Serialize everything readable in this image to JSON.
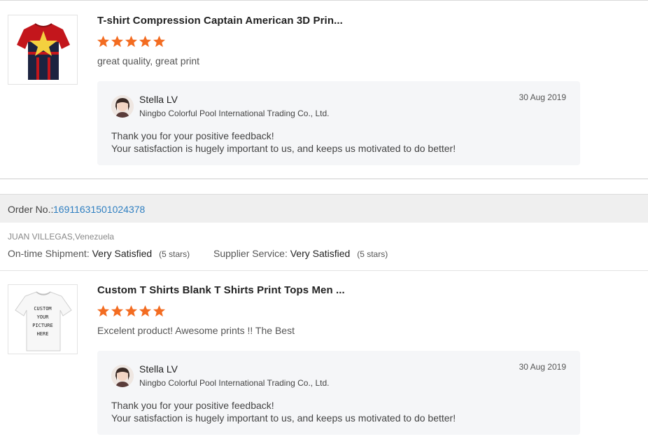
{
  "reviews": [
    {
      "title": "T-shirt Compression Captain American 3D Prin...",
      "rating": 5,
      "comment": "great quality, great print",
      "reply": {
        "name": "Stella LV",
        "company": "Ningbo Colorful Pool International Trading Co., Ltd.",
        "date": "30 Aug 2019",
        "line1": "Thank you for your positive feedback!",
        "line2": "Your satisfaction is hugely important to us, and keeps us motivated to do better!"
      }
    },
    {
      "title": "Custom T Shirts Blank T Shirts Print Tops Men ...",
      "rating": 5,
      "comment": "Excelent product! Awesome prints !! The Best",
      "reply": {
        "name": "Stella LV",
        "company": "Ningbo Colorful Pool International Trading Co., Ltd.",
        "date": "30 Aug 2019",
        "line1": "Thank you for your positive feedback!",
        "line2": "Your satisfaction is hugely important to us, and keeps us motivated to do better!"
      }
    }
  ],
  "order": {
    "label": "Order No.:",
    "number": "16911631501024378"
  },
  "buyer": "JUAN VILLEGAS,Venezuela",
  "metrics": {
    "shipment_label": "On-time Shipment:",
    "shipment_value": "Very Satisfied",
    "shipment_count": "(5 stars)",
    "service_label": "Supplier Service:",
    "service_value": "Very Satisfied",
    "service_count": "(5 stars)"
  },
  "product2_image_text": [
    "CUSTOM",
    "YOUR",
    "PICTURE",
    "HERE"
  ],
  "colors": {
    "star": "#f36c21",
    "link": "#2f7fc1",
    "reply_bg": "#f5f6f8",
    "order_bar_bg": "#efefef"
  },
  "icons": {
    "star": "star-icon",
    "avatar": "avatar"
  }
}
